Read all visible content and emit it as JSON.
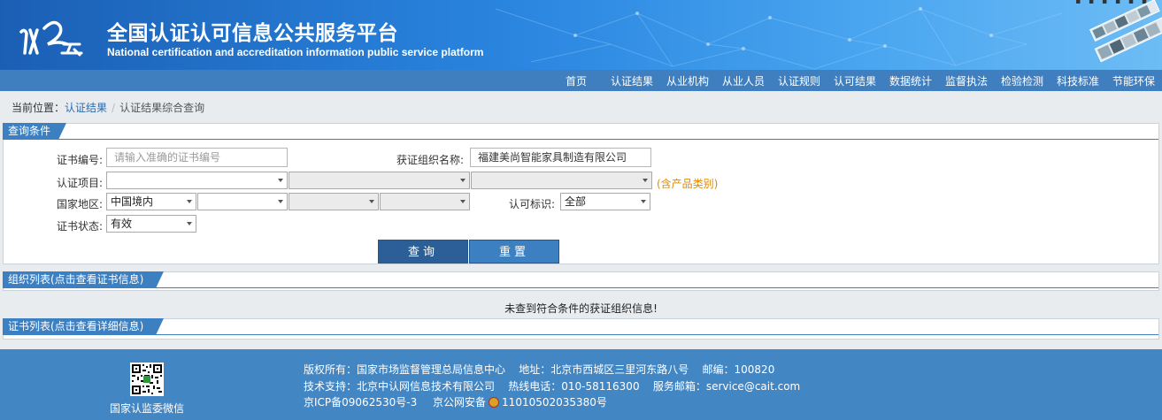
{
  "header": {
    "logo_text": "认云",
    "title": "全国认证认可信息公共服务平台",
    "subtitle": "National certification and accreditation information public service platform"
  },
  "nav": {
    "items": [
      "首页",
      "认证结果",
      "从业机构",
      "从业人员",
      "认证规则",
      "认可结果",
      "数据统计",
      "监督执法",
      "检验检测",
      "科技标准",
      "节能环保"
    ]
  },
  "breadcrumb": {
    "prefix": "当前位置：",
    "link": "认证结果",
    "separator": "/",
    "current": "认证结果综合查询"
  },
  "query": {
    "tab": "查询条件",
    "cert_no_label": "证书编号:",
    "cert_no_placeholder": "请输入准确的证书编号",
    "org_label": "获证组织名称:",
    "org_value": "福建美尚智能家具制造有限公司",
    "project_label": "认证项目:",
    "project_note": "(含产品类别)",
    "region_label": "国家地区:",
    "region_value": "中国境内",
    "mark_label": "认可标识:",
    "mark_value": "全部",
    "status_label": "证书状态:",
    "status_value": "有效",
    "search_button": "查询",
    "reset_button": "重置"
  },
  "org_list": {
    "tab": "组织列表(点击查看证书信息)",
    "empty_message": "未查到符合条件的获证组织信息!"
  },
  "cert_list": {
    "tab": "证书列表(点击查看详细信息)"
  },
  "footer": {
    "qr_caption": "国家认监委微信",
    "line1": "版权所有：国家市场监督管理总局信息中心    地址：北京市西城区三里河东路八号    邮编：100820",
    "line2": "技术支持：北京中认网信息技术有限公司    热线电话：010-58116300    服务邮箱：service@cait.com",
    "line3a": "京ICP备09062530号-3",
    "line3b": "京公网安备",
    "line3c": "11010502035380号"
  },
  "colors": {
    "header_start": "#1b5fb5",
    "nav": "#3f7fc0",
    "tab": "#3d80c2",
    "search_button": "#2c5f97",
    "footer": "#4386c4",
    "note": "#e08a00"
  }
}
